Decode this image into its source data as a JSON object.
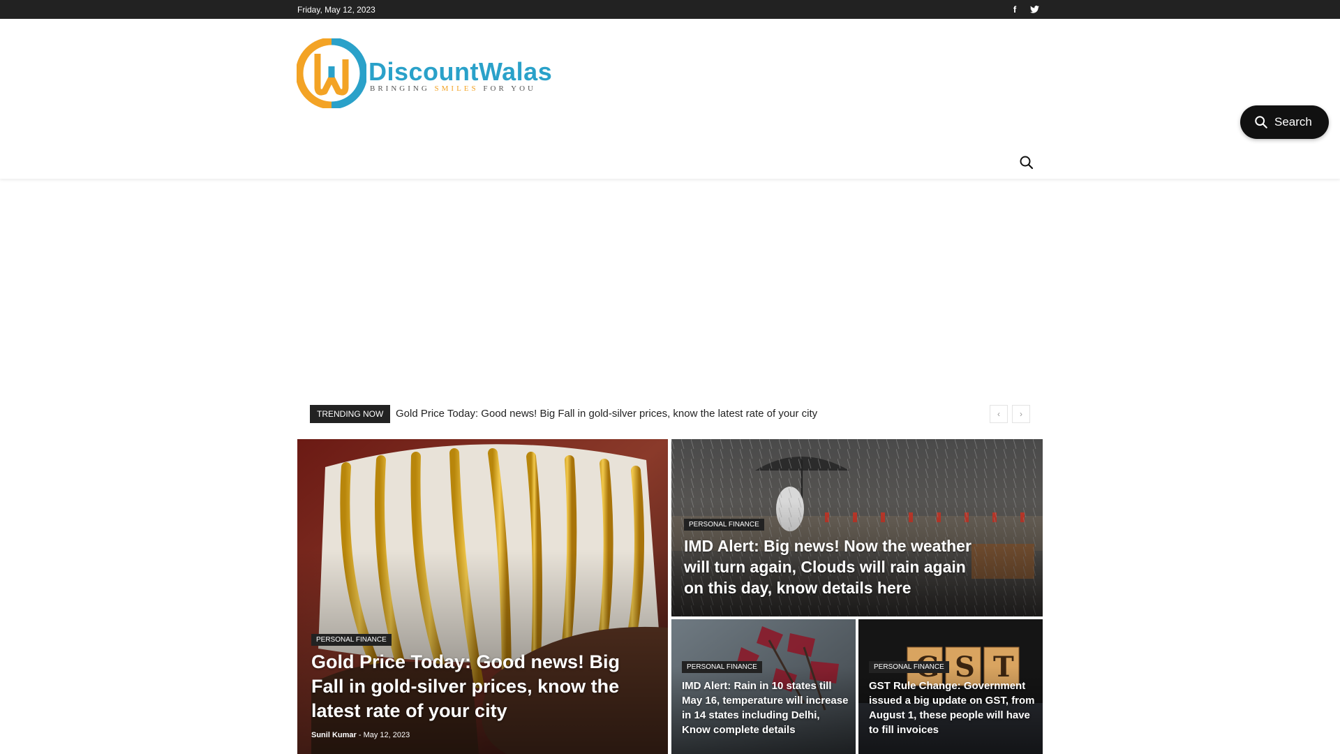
{
  "topbar": {
    "date": "Friday, May 12, 2023",
    "social": [
      {
        "icon": "facebook-icon",
        "glyph": "f"
      },
      {
        "icon": "twitter-icon",
        "glyph": "t"
      }
    ]
  },
  "logo": {
    "name_part1": "Discount",
    "name_part2": "Walas",
    "tagline_part1": "BRINGING ",
    "tagline_highlight": "SMILES",
    "tagline_part2": " FOR YOU",
    "colors": {
      "blue": "#2aa1c9",
      "orange": "#f3a325"
    }
  },
  "search_pill": {
    "label": "Search"
  },
  "trending": {
    "badge": "TRENDING NOW",
    "headline": "Gold Price Today: Good news! Big Fall in gold-silver prices, know the latest rate of your city",
    "prev": "‹",
    "next": "›"
  },
  "articles": [
    {
      "category": "PERSONAL FINANCE",
      "title": "Gold Price Today: Good news! Big Fall in gold-silver prices, know the latest rate of your city",
      "author": "Sunil Kumar",
      "separator": "-",
      "date": "May 12, 2023"
    },
    {
      "category": "PERSONAL FINANCE",
      "title": "IMD Alert: Big news! Now the weather will turn again, Clouds will rain again on this day, know details here"
    },
    {
      "category": "PERSONAL FINANCE",
      "title": "IMD Alert: Rain in 10 states till May 16, temperature will increase in 14 states including Delhi, Know complete details"
    },
    {
      "category": "PERSONAL FINANCE",
      "title": "GST Rule Change: Government issued a big update on GST, from August 1, these people will have to fill invoices"
    }
  ]
}
